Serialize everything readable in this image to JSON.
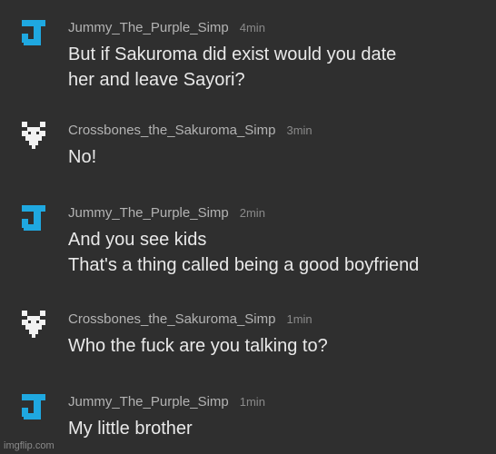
{
  "comments": [
    {
      "username": "Jummy_The_Purple_Simp",
      "time": "4min",
      "avatar": "blue-j-icon",
      "lines": [
        "But if Sakuroma did exist would you date",
        "her and leave Sayori?"
      ]
    },
    {
      "username": "Crossbones_the_Sakuroma_Simp",
      "time": "3min",
      "avatar": "white-pixel-heart-icon",
      "lines": [
        "No!"
      ]
    },
    {
      "username": "Jummy_The_Purple_Simp",
      "time": "2min",
      "avatar": "blue-j-icon",
      "lines": [
        "And you see kids",
        "That's a thing called being a good boyfriend"
      ]
    },
    {
      "username": "Crossbones_the_Sakuroma_Simp",
      "time": "1min",
      "avatar": "white-pixel-heart-icon",
      "lines": [
        "Who the fuck are you talking to?"
      ]
    },
    {
      "username": "Jummy_The_Purple_Simp",
      "time": "1min",
      "avatar": "blue-j-icon",
      "lines": [
        "My little brother"
      ]
    }
  ],
  "colors": {
    "background": "#2f2f2f",
    "avatar_blue": "#1fa8e0",
    "avatar_white": "#f2f2f2",
    "username": "#b3b3b3",
    "time": "#8a8a8a",
    "text": "#e9e9e9"
  },
  "watermark": "imgflip.com"
}
